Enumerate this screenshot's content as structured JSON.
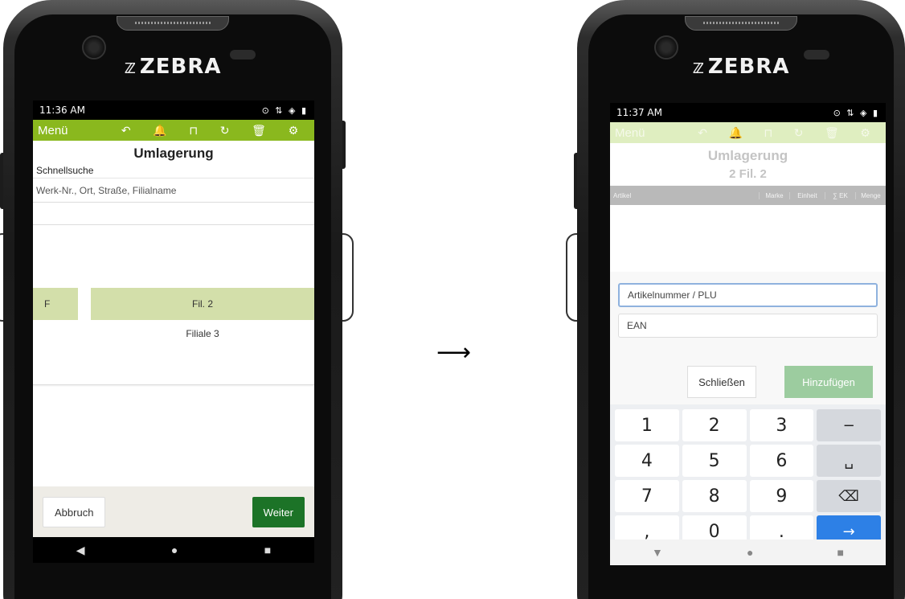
{
  "arrow": "⟶",
  "left_phone": {
    "brand": "ZEBRA",
    "status": {
      "time": "11:36 AM",
      "icons": "⊙ ⇅ ◈ ▮"
    },
    "appbar": {
      "menu_label": "Menü",
      "tool_icons": [
        "↶",
        "🔔",
        "⊓",
        "↻",
        "🗑",
        "⚙"
      ],
      "color": "#8ab81e"
    },
    "title": "Umlagerung",
    "quick_search_label": "Schnellsuche",
    "search_placeholder": "Werk-Nr., Ort, Straße, Filialname",
    "list": {
      "selected": {
        "code": "F",
        "name": "Fil. 2"
      },
      "other": {
        "name": "Filiale 3"
      }
    },
    "footer": {
      "cancel_label": "Abbruch",
      "next_label": "Weiter"
    },
    "nav": [
      "◀",
      "●",
      "■"
    ]
  },
  "right_phone": {
    "brand": "ZEBRA",
    "status": {
      "time": "11:37 AM",
      "icons": "⊙ ⇅ ◈ ▮"
    },
    "appbar": {
      "menu_label": "Menü",
      "tool_icons": [
        "↶",
        "🔔",
        "⊓",
        "↻",
        "🗑",
        "⚙"
      ]
    },
    "title": "Umlagerung",
    "subtitle": "2 Fil. 2",
    "table_headers": [
      "Artikel",
      "Marke",
      "Einheit",
      "∑ EK",
      "Menge"
    ],
    "dialog": {
      "article_placeholder": "Artikelnummer / PLU",
      "ean_placeholder": "EAN",
      "close_label": "Schließen",
      "add_label": "Hinzufügen"
    },
    "keypad": [
      [
        "1",
        "2",
        "3",
        "−"
      ],
      [
        "4",
        "5",
        "6",
        "␣"
      ],
      [
        "7",
        "8",
        "9",
        "⌫"
      ],
      [
        ",",
        "0",
        ".",
        "→"
      ]
    ],
    "nav": [
      "▼",
      "●",
      "■"
    ]
  }
}
